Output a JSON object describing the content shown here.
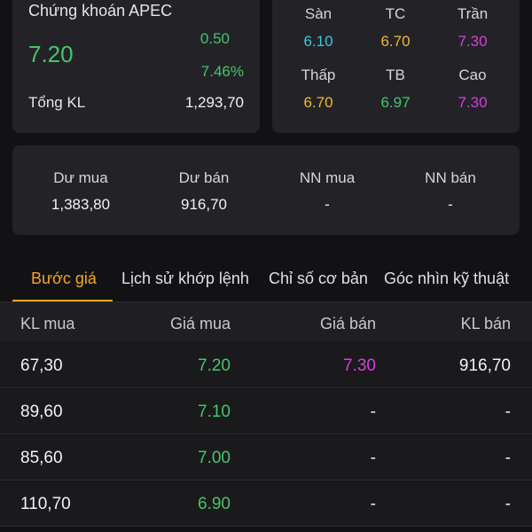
{
  "quote": {
    "name": "Chứng khoán APEC",
    "price": "7.20",
    "change": "0.50",
    "change_pct": "7.46%",
    "volume_label": "Tổng KL",
    "volume_value": "1,293,70"
  },
  "price_range": {
    "row1": [
      {
        "label": "Sàn",
        "value": "6.10",
        "color": "#3ec6e0"
      },
      {
        "label": "TC",
        "value": "6.70",
        "color": "#f5b82e"
      },
      {
        "label": "Trần",
        "value": "7.30",
        "color": "#d83de0"
      }
    ],
    "row2": [
      {
        "label": "Thấp",
        "value": "6.70",
        "color": "#f5b82e"
      },
      {
        "label": "TB",
        "value": "6.97",
        "color": "#45c56a"
      },
      {
        "label": "Cao",
        "value": "7.30",
        "color": "#d83de0"
      }
    ]
  },
  "market": [
    {
      "label": "Dư mua",
      "value": "1,383,80"
    },
    {
      "label": "Dư bán",
      "value": "916,70"
    },
    {
      "label": "NN mua",
      "value": "-"
    },
    {
      "label": "NN bán",
      "value": "-"
    }
  ],
  "tabs": [
    "Bước giá",
    "Lịch sử khớp lệnh",
    "Chỉ số cơ bản",
    "Góc nhìn kỹ thuật"
  ],
  "active_tab": "Bước giá",
  "order_book": {
    "headers": [
      "KL mua",
      "Giá mua",
      "Giá bán",
      "KL bán"
    ],
    "rows": [
      {
        "bid_vol": "67,30",
        "bid": "7.20",
        "ask": "7.30",
        "ask_vol": "916,70"
      },
      {
        "bid_vol": "89,60",
        "bid": "7.10",
        "ask": "-",
        "ask_vol": "-"
      },
      {
        "bid_vol": "85,60",
        "bid": "7.00",
        "ask": "-",
        "ask_vol": "-"
      },
      {
        "bid_vol": "110,70",
        "bid": "6.90",
        "ask": "-",
        "ask_vol": "-"
      }
    ]
  },
  "colors": {
    "up": "#45c56a",
    "ceiling": "#d83de0",
    "floor": "#3ec6e0",
    "reference": "#f5b82e",
    "accent": "#f5a623",
    "text": "#f2f2f4"
  }
}
